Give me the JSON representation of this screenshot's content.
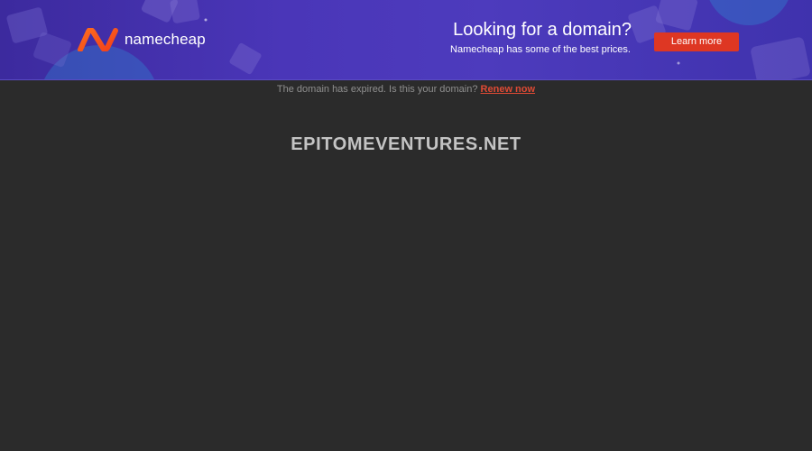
{
  "banner": {
    "brand_name": "namecheap",
    "headline": "Looking for a domain?",
    "subtext": "Namecheap has some of the best prices.",
    "cta_label": "Learn more",
    "colors": {
      "background": "#4a36b8",
      "cta": "#de3723",
      "logo_orange": "#fd6c1e"
    }
  },
  "notice": {
    "text": "The domain has expired. Is this your domain?",
    "link_label": "Renew now",
    "link_color": "#de4a35"
  },
  "domain": {
    "name": "EPITOMEVENTURES.NET"
  },
  "page": {
    "background": "#2b2b2b"
  }
}
